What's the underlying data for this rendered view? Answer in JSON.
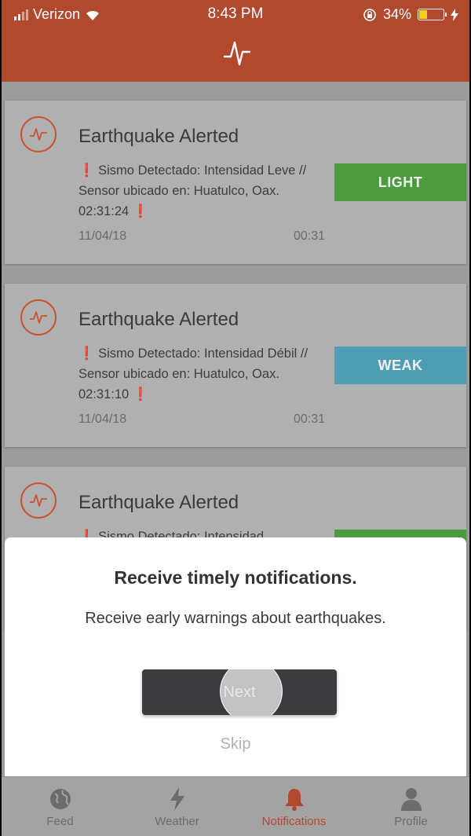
{
  "status_bar": {
    "carrier": "Verizon",
    "time": "8:43 PM",
    "battery_percent": "34%"
  },
  "header": {
    "logo_icon": "pulse-logo-icon"
  },
  "notifications": [
    {
      "title": "Earthquake Alerted",
      "message": "Sismo Detectado: Intensidad Leve // Sensor ubicado en: Huatulco, Oax. 02:31:24",
      "date": "11/04/18",
      "duration": "00:31",
      "level": "LIGHT",
      "level_color": "#4c9b3e"
    },
    {
      "title": "Earthquake Alerted",
      "message": "Sismo Detectado: Intensidad Débil // Sensor ubicado en: Huatulco, Oax. 02:31:10",
      "date": "11/04/18",
      "duration": "00:31",
      "level": "WEAK",
      "level_color": "#4f9db2"
    },
    {
      "title": "Earthquake Alerted",
      "message": "Sismo Detectado: Intensidad",
      "level_color": "#4c9b3e"
    }
  ],
  "modal": {
    "title": "Receive timely notifications.",
    "subtitle": "Receive early warnings about earthquakes.",
    "next_label": "Next",
    "skip_label": "Skip"
  },
  "tabs": [
    {
      "label": "Feed",
      "icon": "globe-icon"
    },
    {
      "label": "Weather",
      "icon": "lightning-icon"
    },
    {
      "label": "Notifications",
      "icon": "bell-icon",
      "active": true
    },
    {
      "label": "Profile",
      "icon": "person-icon"
    }
  ],
  "colors": {
    "brand": "#b0492e",
    "accent": "#c9532e"
  }
}
